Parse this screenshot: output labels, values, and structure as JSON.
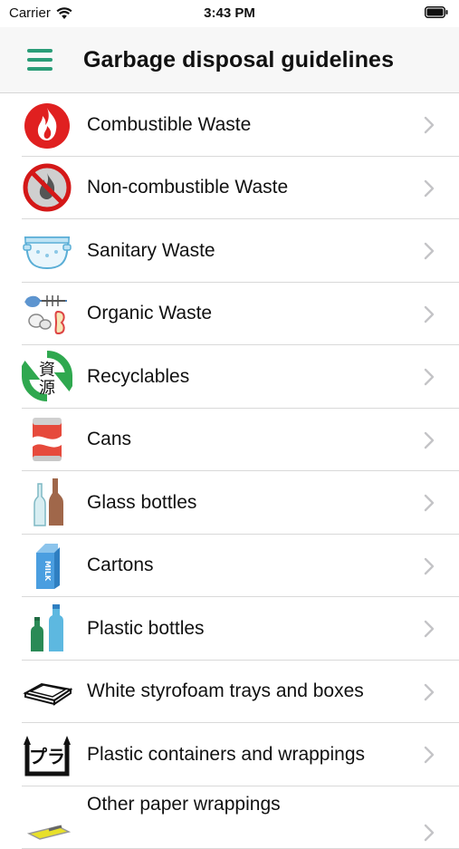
{
  "status_bar": {
    "carrier": "Carrier",
    "time": "3:43 PM"
  },
  "header": {
    "title": "Garbage disposal guidelines",
    "menu_icon": "hamburger-menu-icon",
    "accent_color": "#2a9d78"
  },
  "categories": [
    {
      "label": "Combustible Waste",
      "icon": "fire-icon"
    },
    {
      "label": "Non-combustible Waste",
      "icon": "no-fire-icon"
    },
    {
      "label": "Sanitary Waste",
      "icon": "diaper-icon"
    },
    {
      "label": "Organic Waste",
      "icon": "food-scraps-icon"
    },
    {
      "label": "Recyclables",
      "icon": "recycle-resources-icon",
      "icon_text": "資源"
    },
    {
      "label": "Cans",
      "icon": "can-icon"
    },
    {
      "label": "Glass bottles",
      "icon": "glass-bottles-icon"
    },
    {
      "label": "Cartons",
      "icon": "milk-carton-icon",
      "icon_text": "MILK"
    },
    {
      "label": "Plastic bottles",
      "icon": "plastic-bottles-icon"
    },
    {
      "label": "White styrofoam trays and boxes",
      "icon": "styrofoam-tray-icon"
    },
    {
      "label": "Plastic containers and wrappings",
      "icon": "plastic-recycle-mark-icon",
      "icon_text": "プラ"
    },
    {
      "label": "Other paper wrappings",
      "icon": "paper-wrapping-icon"
    }
  ]
}
